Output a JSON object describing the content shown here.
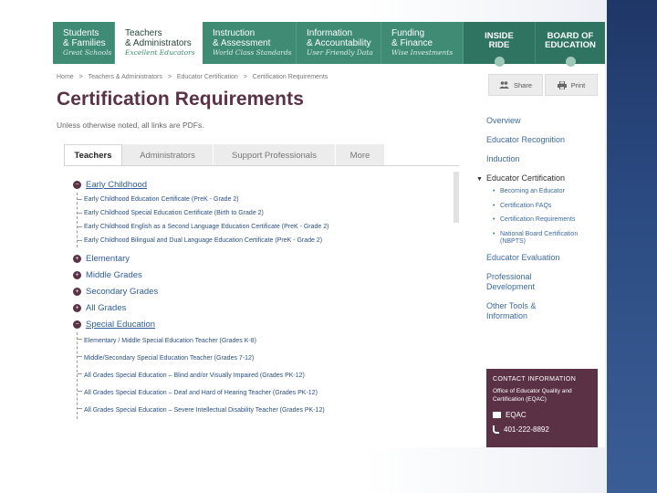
{
  "nav": {
    "items": [
      {
        "l1": "Students",
        "l2": "& Families",
        "tag": "Great Schools"
      },
      {
        "l1": "Teachers",
        "l2": "& Administrators",
        "tag": "Excellent Educators"
      },
      {
        "l1": "Instruction",
        "l2": "& Assessment",
        "tag": "World Class Standards"
      },
      {
        "l1": "Information",
        "l2": "& Accountability",
        "tag": "User Friendly Data"
      },
      {
        "l1": "Funding",
        "l2": "& Finance",
        "tag": "Wise Investments"
      }
    ],
    "inside_l1": "INSIDE",
    "inside_l2": "RIDE",
    "board_l1": "BOARD OF",
    "board_l2": "EDUCATION"
  },
  "breadcrumb": [
    "Home",
    ">",
    "Teachers & Administrators",
    ">",
    "Educator Certification",
    ">",
    "Certification Requirements"
  ],
  "page_title": "Certification Requirements",
  "subnote": "Unless otherwise noted, all links are PDFs.",
  "tabs": [
    "Teachers",
    "Administrators",
    "Support Professionals",
    "More"
  ],
  "tree": {
    "early_childhood": {
      "label": "Early Childhood",
      "items": [
        "Early Childhood Education Certificate (PreK - Grade 2)",
        "Early Childhood Special Education Certificate (Birth to Grade 2)",
        "Early Childhood English as a Second Language Education Certificate (PreK - Grade 2)",
        "Early Childhood Bilingual and Dual Language Education Certificate (PreK - Grade 2)"
      ]
    },
    "elementary": "Elementary",
    "middle": "Middle Grades",
    "secondary": "Secondary Grades",
    "all_grades": "All Grades",
    "special_ed": {
      "label": "Special Education",
      "items": [
        "Elementary / Middle Special Education Teacher (Grades K-8)",
        "Middle/Secondary Special Education Teacher (Grades 7-12)",
        "All Grades Special Education – Blind and/or Visually Impaired (Grades PK-12)",
        "All Grades Special Education – Deaf and Hard of Hearing Teacher (Grades PK-12)",
        "All Grades Special Education – Severe Intellectual Disability Teacher (Grades PK-12)"
      ]
    }
  },
  "actions": {
    "share": "Share",
    "print": "Print"
  },
  "rightnav": {
    "top": [
      "Overview",
      "Educator Recognition",
      "Induction"
    ],
    "section": "Educator Certification",
    "sub": [
      "Becoming an Educator",
      "Certification FAQs",
      "Certification Requirements",
      "National Board Certification (NBPTS)"
    ],
    "bottom": [
      "Educator Evaluation",
      "Professional Development",
      "Other Tools & Information"
    ]
  },
  "contact": {
    "title": "CONTACT INFORMATION",
    "office": "Office of Educator Quality and Certification (EQAC)",
    "email_label": "EQAC",
    "phone": "401-222-8892"
  }
}
